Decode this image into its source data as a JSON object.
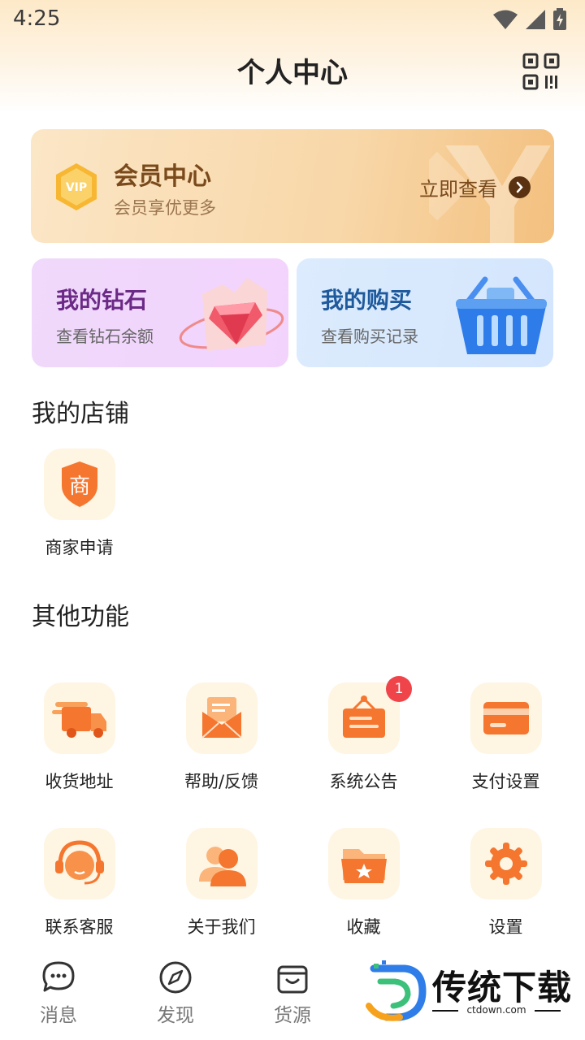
{
  "status_bar": {
    "time": "4:25"
  },
  "header": {
    "title": "个人中心",
    "qr_icon": "qr-code-icon"
  },
  "vip_card": {
    "title": "会员中心",
    "subtitle": "会员享优更多",
    "link": "立即查看"
  },
  "cards": [
    {
      "title": "我的钻石",
      "subtitle": "查看钻石余额"
    },
    {
      "title": "我的购买",
      "subtitle": "查看购买记录"
    }
  ],
  "shop_section": {
    "title": "我的店铺",
    "items": [
      {
        "label": "商家申请",
        "icon": "merchant-shield-icon"
      }
    ]
  },
  "other_section": {
    "title": "其他功能",
    "items": [
      {
        "label": "收货地址",
        "icon": "delivery-truck-icon"
      },
      {
        "label": "帮助/反馈",
        "icon": "mail-envelope-icon"
      },
      {
        "label": "系统公告",
        "icon": "notice-board-icon",
        "badge": "1"
      },
      {
        "label": "支付设置",
        "icon": "credit-card-icon"
      },
      {
        "label": "联系客服",
        "icon": "customer-service-icon"
      },
      {
        "label": "关于我们",
        "icon": "people-icon"
      },
      {
        "label": "收藏",
        "icon": "favorite-folder-icon"
      },
      {
        "label": "设置",
        "icon": "gear-icon"
      }
    ]
  },
  "tabbar": [
    {
      "label": "消息",
      "icon": "chat-bubble-icon"
    },
    {
      "label": "发现",
      "icon": "compass-icon"
    },
    {
      "label": "货源",
      "icon": "shopping-bag-icon"
    }
  ],
  "watermark": {
    "text": "传统下载",
    "url": "ctdown.com"
  },
  "colors": {
    "accent_orange": "#f7742e",
    "vip_brown": "#7a4a1c",
    "badge_red": "#f0444b"
  }
}
